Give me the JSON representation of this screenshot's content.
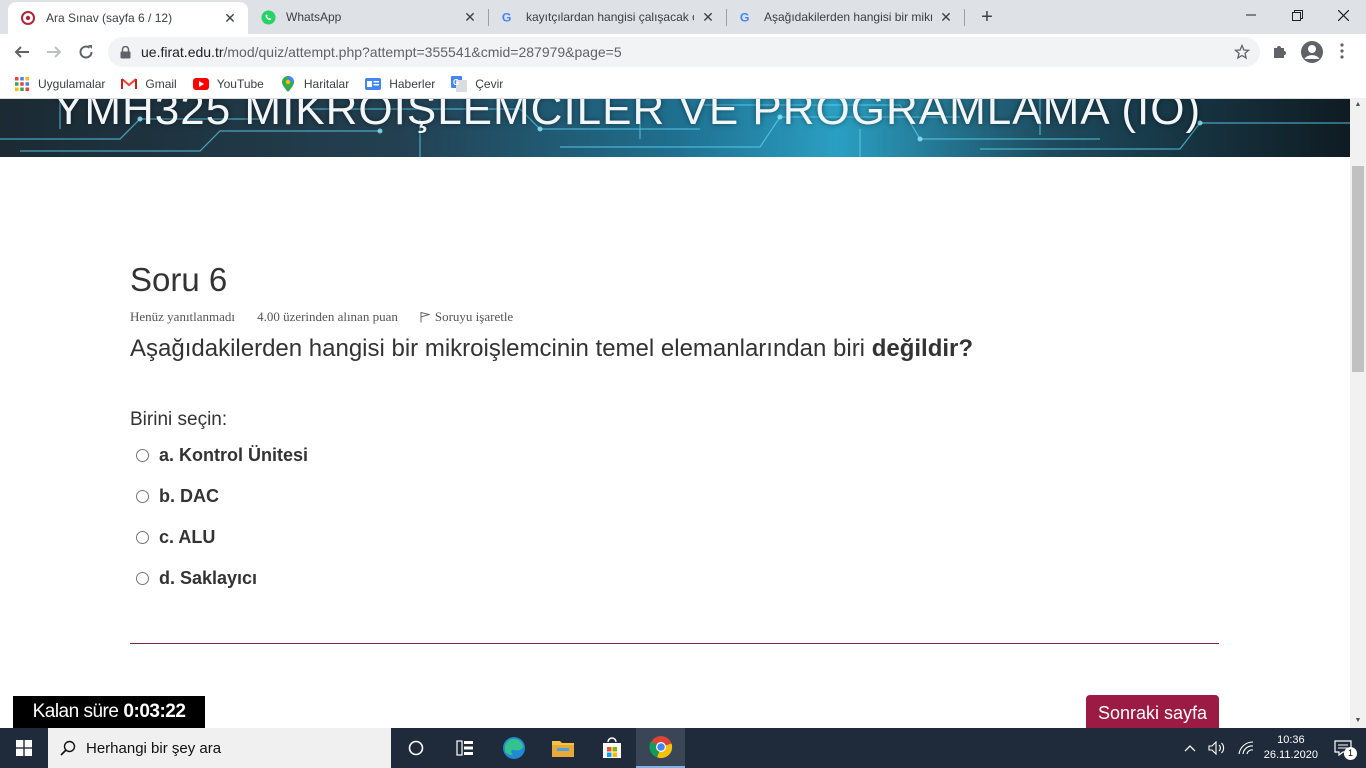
{
  "tabs": [
    {
      "title": "Ara Sınav (sayfa 6 / 12)",
      "active": true
    },
    {
      "title": "WhatsApp",
      "active": false
    },
    {
      "title": "kayıtçılardan hangisi çalışacak ola",
      "active": false
    },
    {
      "title": "Aşağıdakilerden hangisi bir mikro",
      "active": false
    }
  ],
  "address": {
    "host": "ue.firat.edu.tr",
    "path": "/mod/quiz/attempt.php?attempt=355541&cmid=287979&page=5"
  },
  "bookmarks": [
    {
      "label": "Uygulamalar",
      "icon": "apps-grid-icon"
    },
    {
      "label": "Gmail",
      "icon": "gmail-icon"
    },
    {
      "label": "YouTube",
      "icon": "youtube-icon"
    },
    {
      "label": "Haritalar",
      "icon": "maps-pin-icon"
    },
    {
      "label": "Haberler",
      "icon": "news-icon"
    },
    {
      "label": "Çevir",
      "icon": "translate-icon"
    }
  ],
  "banner": {
    "title": "YMH325 MİKROİŞLEMCİLER VE PROGRAMLAMA (İÖ)"
  },
  "question": {
    "heading": "Soru 6",
    "status": "Henüz yanıtlanmadı",
    "points": "4.00 üzerinden alınan puan",
    "flag_label": "Soruyu işaretle",
    "text_main": "Aşağıdakilerden hangisi bir mikroişlemcinin temel elemanlarından biri ",
    "text_emphasis": "değildir?",
    "prompt": "Birini seçin:",
    "answers": [
      "a. Kontrol Ünitesi",
      "b. DAC",
      "c. ALU",
      "d. Saklayıcı"
    ]
  },
  "timer": {
    "label": "Kalan süre",
    "value": "0:03:22"
  },
  "next_button": "Sonraki sayfa",
  "taskbar": {
    "search_placeholder": "Herhangi bir şey ara",
    "time": "10:36",
    "date": "26.11.2020",
    "notification_count": "1"
  },
  "colors": {
    "accent": "#9b1b45",
    "divider": "#7c2456",
    "taskbar": "#1f2b3a"
  }
}
